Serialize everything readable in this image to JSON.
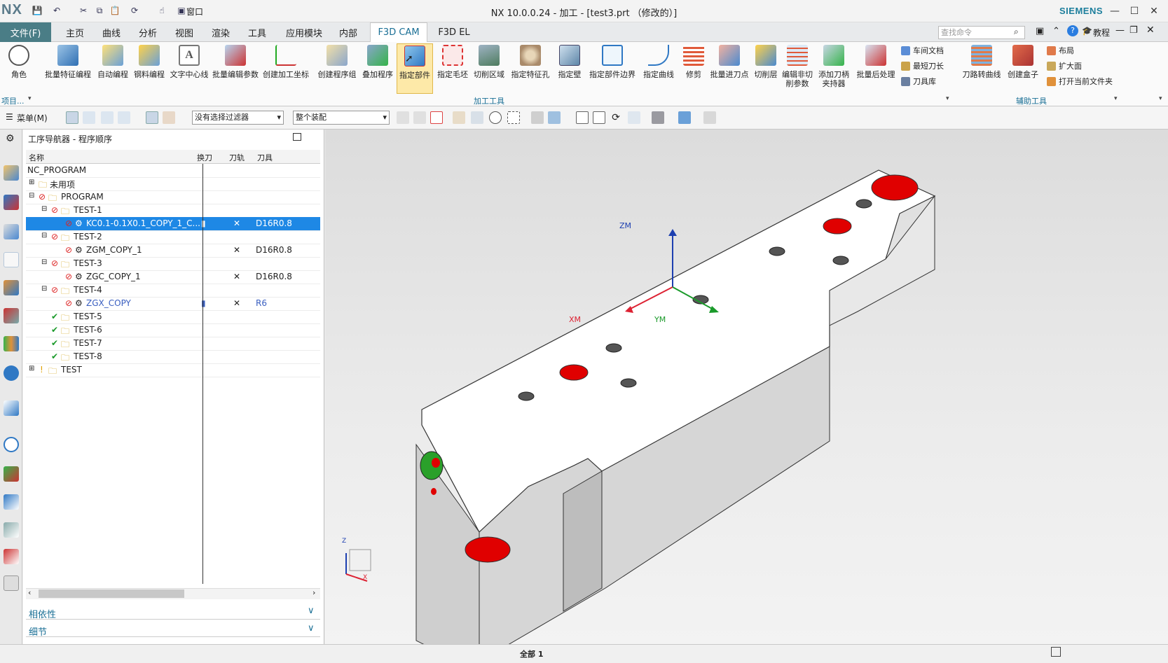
{
  "app": {
    "logo": "NX",
    "title": "NX 10.0.0.24 - 加工 - [test3.prt （修改的）]",
    "brand": "SIEMENS",
    "window_menu": "窗口"
  },
  "tabs": [
    {
      "label": "文件(F)"
    },
    {
      "label": "主页"
    },
    {
      "label": "曲线"
    },
    {
      "label": "分析"
    },
    {
      "label": "视图"
    },
    {
      "label": "渲染"
    },
    {
      "label": "工具"
    },
    {
      "label": "应用模块"
    },
    {
      "label": "内部"
    },
    {
      "label": "F3D CAM"
    },
    {
      "label": "F3D EL"
    }
  ],
  "search": {
    "placeholder": "查找命令"
  },
  "help": {
    "tutorial": "教程"
  },
  "ribbon": {
    "buttons": [
      {
        "label": "角色"
      },
      {
        "label": "批量特征编程"
      },
      {
        "label": "自动编程"
      },
      {
        "label": "钢料编程"
      },
      {
        "label": "文字中心线"
      },
      {
        "label": "批量编辑参数"
      },
      {
        "label": "创建加工坐标"
      },
      {
        "label": "创建程序组"
      },
      {
        "label": "叠加程序"
      },
      {
        "label": "指定部件"
      },
      {
        "label": "指定毛坯"
      },
      {
        "label": "切削区域"
      },
      {
        "label": "指定特征孔"
      },
      {
        "label": "指定壁"
      },
      {
        "label": "指定部件边界"
      },
      {
        "label": "指定曲线"
      },
      {
        "label": "修剪"
      },
      {
        "label": "批量进刀点"
      },
      {
        "label": "切削层"
      },
      {
        "label": "编辑非切削参数"
      },
      {
        "label": "添加刀柄夹持器"
      },
      {
        "label": "批量后处理"
      },
      {
        "label": "刀路转曲线"
      },
      {
        "label": "创建盒子"
      }
    ],
    "small_col1": [
      "车间文档",
      "最短刀长",
      "刀具库"
    ],
    "small_col2": [
      "布局",
      "扩大面",
      "打开当前文件夹"
    ],
    "group_items": "项目...",
    "group_machining": "加工工具",
    "group_aux": "辅助工具"
  },
  "toolbar": {
    "menu": "菜单(M)",
    "filter": "没有选择过滤器",
    "assembly": "整个装配"
  },
  "navigator": {
    "title": "工序导航器 - 程序顺序",
    "columns": [
      "名称",
      "换刀",
      "刀轨",
      "刀具"
    ],
    "rows": [
      {
        "name": "NC_PROGRAM",
        "tool": ""
      },
      {
        "name": "未用项",
        "tool": ""
      },
      {
        "name": "PROGRAM",
        "tool": ""
      },
      {
        "name": "TEST-1",
        "tool": ""
      },
      {
        "name": "KC0.1-0.1X0.1_COPY_1_C...",
        "tool": "D16R0.8",
        "path": "✕"
      },
      {
        "name": "TEST-2",
        "tool": ""
      },
      {
        "name": "ZGM_COPY_1",
        "tool": "D16R0.8",
        "path": "✕"
      },
      {
        "name": "TEST-3",
        "tool": ""
      },
      {
        "name": "ZGC_COPY_1",
        "tool": "D16R0.8",
        "path": "✕"
      },
      {
        "name": "TEST-4",
        "tool": ""
      },
      {
        "name": "ZGX_COPY",
        "tool": "R6",
        "path": "✕"
      },
      {
        "name": "TEST-5",
        "tool": ""
      },
      {
        "name": "TEST-6",
        "tool": ""
      },
      {
        "name": "TEST-7",
        "tool": ""
      },
      {
        "name": "TEST-8",
        "tool": ""
      },
      {
        "name": "TEST",
        "tool": ""
      }
    ],
    "dependencies": "相依性",
    "details": "细节"
  },
  "viewport": {
    "axis_zm": "ZM",
    "axis_xm": "XM",
    "axis_ym": "YM",
    "triad_z": "Z",
    "triad_x": "X"
  },
  "status": {
    "text": "全部 1"
  },
  "colors": {
    "accent": "#1a6f95",
    "file_tab": "#4a7d86",
    "selection": "#1e88e5",
    "hole_red": "#e00000"
  }
}
